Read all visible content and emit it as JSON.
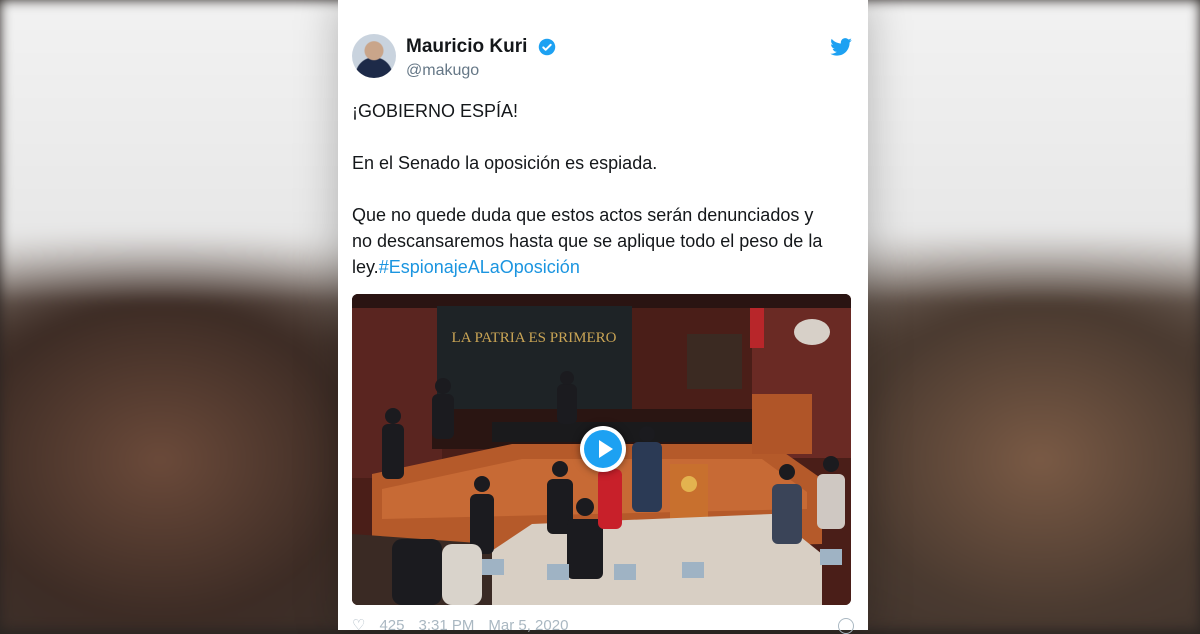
{
  "tweet": {
    "author_name": "Mauricio Kuri",
    "handle": "@makugo",
    "line1": "¡GOBIERNO ESPÍA!",
    "line2": "En el Senado la oposición es espiada.",
    "line3": "Que no quede duda que estos actos serán denunciados y",
    "line4": "no descansaremos hasta que se aplique todo el peso de la",
    "line5_prefix": "ley.",
    "hashtag": "#EspionajeALaOposición",
    "video_banner_text": "LA PATRIA ES PRIMERO",
    "likes": "425",
    "time": "3:31 PM",
    "date": "Mar 5, 2020"
  },
  "colors": {
    "twitter_blue": "#1da1f2",
    "hashtag": "#1b95e0",
    "text": "#14171a",
    "muted": "#657786"
  },
  "icons": [
    "verified-badge-icon",
    "twitter-bird-icon",
    "play-icon",
    "heart-icon",
    "info-icon"
  ]
}
